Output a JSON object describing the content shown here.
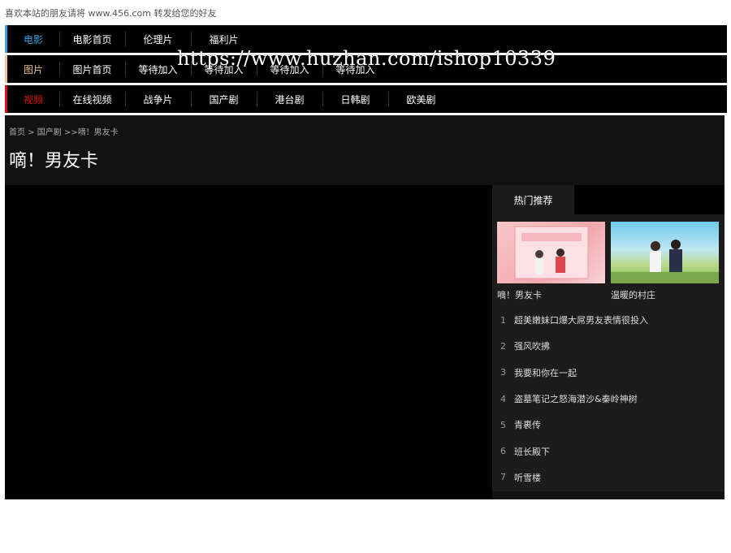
{
  "topline": "喜欢本站的朋友请将 www.456.com 转发给您的好友",
  "watermark": "https://www.huzhan.com/ishop10339",
  "nav": {
    "rows": [
      {
        "category": "电影",
        "cat_color": "#3ea2e6",
        "items": [
          "电影首页",
          "伦理片",
          "福利片"
        ]
      },
      {
        "category": "图片",
        "cat_color": "#f0c38a",
        "items": [
          "图片首页",
          "等待加入",
          "等待加入",
          "等待加入",
          "等待加入"
        ]
      },
      {
        "category": "视频",
        "cat_color": "#e01010",
        "items": [
          "在线视频",
          "战争片",
          "国产剧",
          "港台剧",
          "日韩剧",
          "欧美剧"
        ]
      }
    ]
  },
  "breadcrumb": {
    "home": "首页",
    "sep1": " > ",
    "section": "国产剧",
    "sep2": " >>",
    "current": "嘀！男友卡"
  },
  "title": "嘀！男友卡",
  "sidebar": {
    "tab": "热门推荐",
    "thumbs": [
      {
        "caption": "嘀！男友卡"
      },
      {
        "caption": "温暖的村庄"
      }
    ],
    "list": [
      {
        "num": "1",
        "text": "超美嫩妹口爆大屌男友表情很投入"
      },
      {
        "num": "2",
        "text": "强风吹拂"
      },
      {
        "num": "3",
        "text": "我要和你在一起"
      },
      {
        "num": "4",
        "text": "盗墓笔记之怒海潜沙&秦岭神树"
      },
      {
        "num": "5",
        "text": "青裹传"
      },
      {
        "num": "6",
        "text": "班长殿下"
      },
      {
        "num": "7",
        "text": "听雪楼"
      }
    ]
  }
}
